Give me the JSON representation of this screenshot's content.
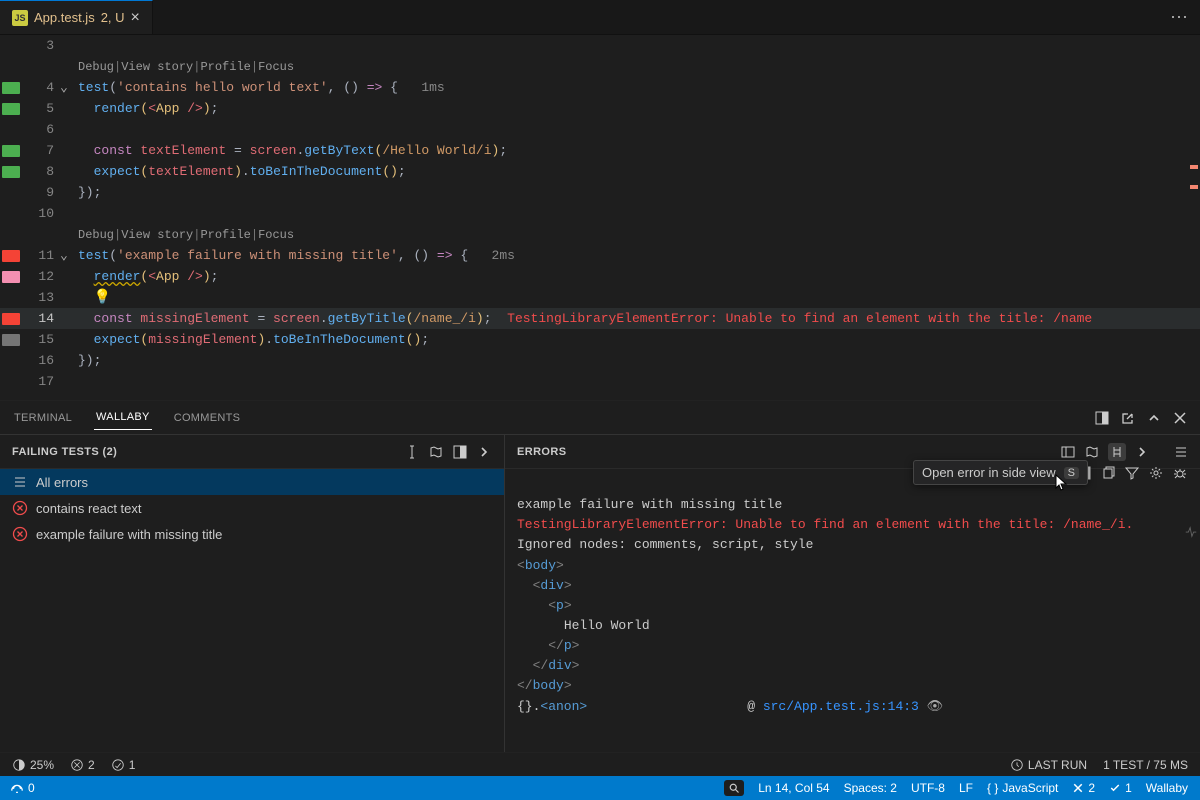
{
  "tab": {
    "filename": "App.test.js",
    "badge": "2, U"
  },
  "codelens": {
    "debug": "Debug",
    "viewstory": "View story",
    "profile": "Profile",
    "focus": "Focus"
  },
  "timing1": "1ms",
  "timing2": "2ms",
  "lines": {
    "l3": "3",
    "l4": "4",
    "l5": "5",
    "l6": "6",
    "l7": "7",
    "l8": "8",
    "l9": "9",
    "l10": "10",
    "l11": "11",
    "l12": "12",
    "l13": "13",
    "l14": "14",
    "l15": "15",
    "l16": "16",
    "l17": "17"
  },
  "code": {
    "t1": {
      "test": "test",
      "s": "(",
      "str": "'contains hello world text'",
      "c": ", ",
      "arrow": "() => {",
      "t": "  "
    },
    "t1b": {
      "render": "render",
      "p1": "(",
      "jsx": "<App />",
      "p2": ");"
    },
    "t1c": {
      "kw": "const ",
      "id": "textElement",
      "eq": " = ",
      "scr": "screen",
      "dot": ".",
      "m": "getByText",
      "p1": "(",
      "rgx": "/Hello World/i",
      "p2": ");"
    },
    "t1d": {
      "exp": "expect",
      "p1": "(",
      "id": "textElement",
      "p2": ").",
      "m": "toBeInTheDocument",
      "p3": "();"
    },
    "t1e": {
      "end": "});"
    },
    "t2": {
      "test": "test",
      "s": "(",
      "str": "'example failure with missing title'",
      "c": ", ",
      "arrow": "() => {",
      "t": "  "
    },
    "t2b": {
      "render": "render",
      "p1": "(",
      "jsx": "<App />",
      "p2": ");"
    },
    "t2c": {
      "kw": "const ",
      "id": "missingElement",
      "eq": " = ",
      "scr": "screen",
      "dot": ".",
      "m": "getByTitle",
      "p1": "(",
      "rgx": "/name_/i",
      "p2": ");  ",
      "err": "TestingLibraryElementError: Unable to find an element with the title: /name"
    },
    "t2d": {
      "exp": "expect",
      "p1": "(",
      "id": "missingElement",
      "p2": ").",
      "m": "toBeInTheDocument",
      "p3": "();"
    },
    "t2e": {
      "end": "});"
    }
  },
  "panel_tabs": {
    "terminal": "TERMINAL",
    "wallaby": "WALLABY",
    "comments": "COMMENTS"
  },
  "left_panel": {
    "title": "FAILING TESTS (2)",
    "rows": [
      "All errors",
      "contains react text",
      "example failure with missing title"
    ]
  },
  "right_panel": {
    "title": "ERRORS",
    "tooltip": "Open error in side view",
    "tooltip_key": "S",
    "lines": {
      "l0": "example failure with missing title",
      "l1": "TestingLibraryElementError: Unable to find an element with the title: /name_/i.",
      "l2": "Ignored nodes: comments, script, style",
      "l3_open": "<",
      "l3_tag": "body",
      "l3_close": ">",
      "l4_open": "  <",
      "l4_tag": "div",
      "l4_close": ">",
      "l5_open": "    <",
      "l5_tag": "p",
      "l5_close": ">",
      "l6": "      Hello World",
      "l7_open": "    </",
      "l7_tag": "p",
      "l7_close": ">",
      "l8_open": "  </",
      "l8_tag": "div",
      "l8_close": ">",
      "l9_open": "</",
      "l9_tag": "body",
      "l9_close": ">",
      "l10a": "{}.",
      "l10b": "<anon>",
      "l10_at": "@ ",
      "l10_loc": "src/App.test.js:14:3"
    }
  },
  "statusbar1": {
    "zoom": "25%",
    "errors": "2",
    "warnings": "1",
    "lastrun": "LAST RUN",
    "teststat": "1 TEST / 75 MS"
  },
  "statusbar2": {
    "ports": "0",
    "ln": "Ln 14, Col 54",
    "spaces": "Spaces: 2",
    "enc": "UTF-8",
    "eol": "LF",
    "lang": "JavaScript",
    "fail": "2",
    "pass": "1",
    "wallaby": "Wallaby"
  }
}
